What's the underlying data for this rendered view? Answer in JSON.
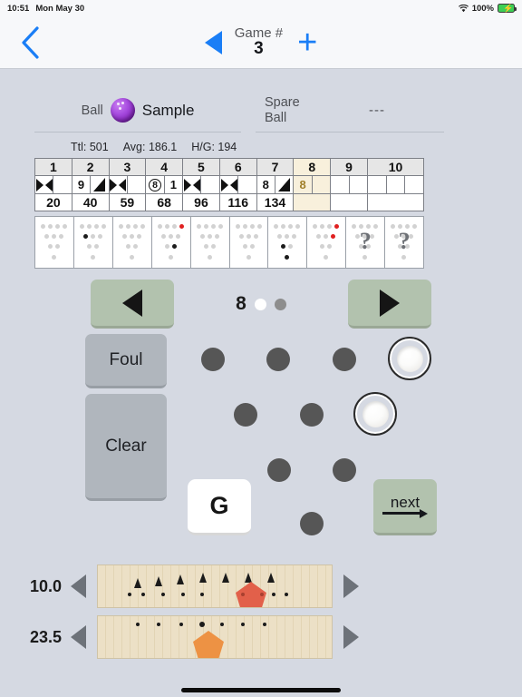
{
  "status_bar": {
    "time": "10:51",
    "date": "Mon May 30",
    "battery_pct": "100%",
    "wifi_icon": "wifi-icon",
    "battery_icon": "battery-charging-icon"
  },
  "nav": {
    "back_icon": "back-chevron-icon",
    "prev_game_icon": "previous-game-triangle-icon",
    "game_label": "Game #",
    "game_number": "3",
    "add_icon": "plus-icon"
  },
  "ball_select": {
    "ball_label": "Ball",
    "ball_name": "Sample",
    "ball_icon": "bowling-ball-icon",
    "spare_label_line1": "Spare",
    "spare_label_line2": "Ball",
    "spare_value": "---"
  },
  "stats": {
    "total": "Ttl: 501",
    "average": "Avg: 186.1",
    "high_game": "H/G: 194"
  },
  "scoresheet": {
    "frame_numbers": [
      "1",
      "2",
      "3",
      "4",
      "5",
      "6",
      "7",
      "8",
      "9",
      "10"
    ],
    "active_frame": 8,
    "frames": [
      {
        "balls": [
          "strike",
          ""
        ],
        "score": "20"
      },
      {
        "balls": [
          "9",
          "spare"
        ],
        "score": "40"
      },
      {
        "balls": [
          "strike",
          ""
        ],
        "score": "59"
      },
      {
        "balls": [
          "(8)",
          "1"
        ],
        "score": "68"
      },
      {
        "balls": [
          "strike",
          ""
        ],
        "score": "96"
      },
      {
        "balls": [
          "strike",
          ""
        ],
        "score": "116"
      },
      {
        "balls": [
          "8",
          "spare"
        ],
        "score": "134"
      },
      {
        "balls": [
          "8",
          ""
        ],
        "score": ""
      },
      {
        "balls": [
          "",
          ""
        ],
        "score": ""
      },
      {
        "balls": [
          "",
          "",
          ""
        ],
        "score": ""
      }
    ]
  },
  "pin_decks": [
    {
      "standing": [],
      "red": [],
      "unknown": false
    },
    {
      "standing": [
        "r2c1"
      ],
      "red": [],
      "unknown": false
    },
    {
      "standing": [],
      "red": [],
      "unknown": false
    },
    {
      "standing": [
        "r3c2"
      ],
      "red": [
        "r1c4"
      ],
      "unknown": false
    },
    {
      "standing": [],
      "red": [],
      "unknown": false
    },
    {
      "standing": [],
      "red": [],
      "unknown": false
    },
    {
      "standing": [
        "r3c1",
        "r4c1"
      ],
      "red": [],
      "unknown": false
    },
    {
      "standing": [],
      "red": [
        "r1c4",
        "r2c3"
      ],
      "unknown": false
    },
    {
      "standing": [],
      "red": [],
      "unknown": true,
      "mark": "?"
    },
    {
      "standing": [],
      "red": [],
      "unknown": true,
      "mark": "?"
    }
  ],
  "frame_nav": {
    "prev_icon": "previous-frame-triangle-icon",
    "next_icon": "next-frame-triangle-icon",
    "frame_number": "8",
    "ball_dot_1": "current-ball-dot",
    "ball_dot_2": "second-ball-dot"
  },
  "pad": {
    "foul_label": "Foul",
    "clear_label": "Clear",
    "gutter_label": "G",
    "next_label": "next",
    "next_arrow_icon": "right-arrow-icon",
    "pins_standing": [
      "pin-7",
      "pin-4"
    ],
    "pins_down": [
      "pin-10",
      "pin-9",
      "pin-8",
      "pin-5",
      "pin-6",
      "pin-2",
      "pin-3",
      "pin-1"
    ]
  },
  "lanes": [
    {
      "value": "10.0",
      "left_icon": "lane-left-arrow-icon",
      "right_icon": "lane-right-arrow-icon",
      "marker_color": "#e2604a",
      "marker_icon": "red-pentagon-marker",
      "arrows": 7,
      "dots": 9
    },
    {
      "value": "23.5",
      "left_icon": "lane-left-arrow-icon",
      "right_icon": "lane-right-arrow-icon",
      "marker_color": "#ed9244",
      "marker_icon": "orange-pentagon-marker",
      "arrows": 0,
      "dots": 7
    }
  ],
  "colors": {
    "background": "#d5d9e2",
    "bar": "#f7f8fa",
    "accent_blue": "#1a7ef6",
    "sage_button": "#b2c2ae",
    "gray_button": "#b0b6bd",
    "active_frame": "#f8f0dc",
    "lane_wood": "#ece0c6"
  }
}
